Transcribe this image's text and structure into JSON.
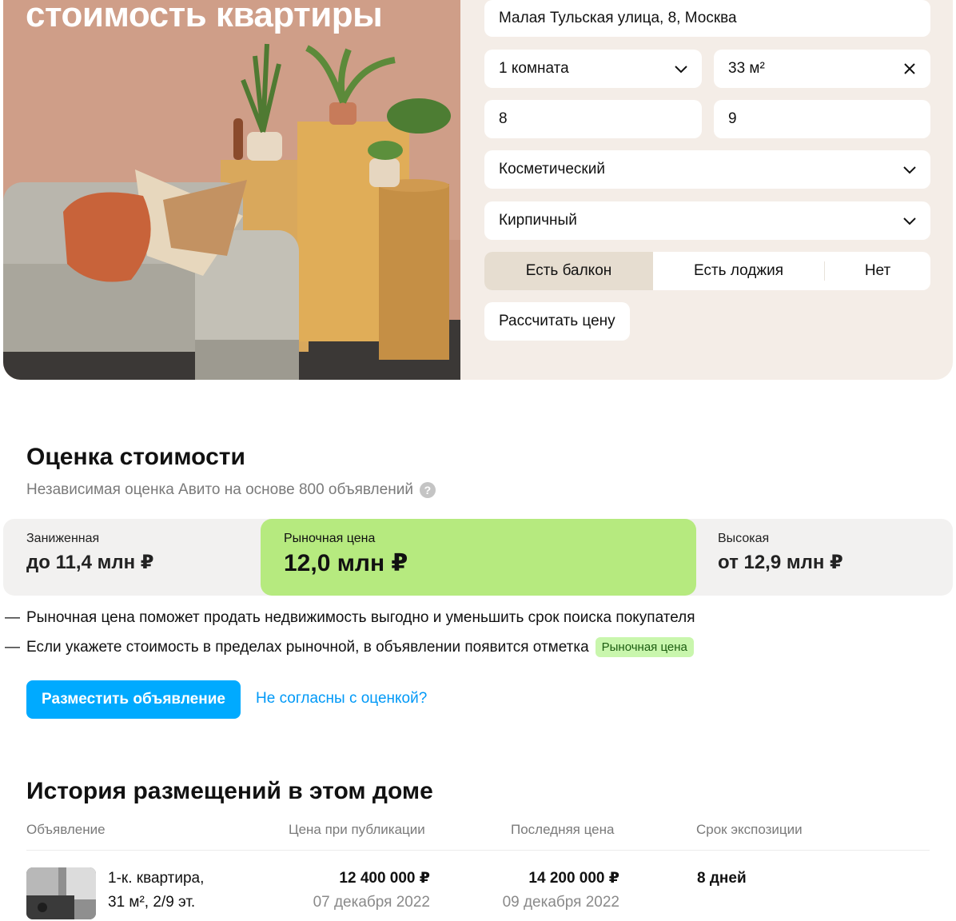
{
  "hero": {
    "title": "стоимость квартиры"
  },
  "form": {
    "address": "Малая Тульская улица, 8, Москва",
    "rooms": "1 комната",
    "area": "33 м²",
    "floor": "8",
    "floors_total": "9",
    "renovation": "Косметический",
    "house_type": "Кирпичный",
    "balcony_options": [
      "Есть балкон",
      "Есть лоджия",
      "Нет"
    ],
    "balcony_selected": "Есть балкон",
    "calc_button": "Рассчитать цену"
  },
  "evaluation": {
    "title": "Оценка стоимости",
    "subtitle": "Независимая оценка Авито на основе 800 объявлений",
    "low": {
      "label": "Заниженная",
      "value": "до 11,4 млн ₽"
    },
    "market": {
      "label": "Рыночная цена",
      "value": "12,0 млн ₽"
    },
    "high": {
      "label": "Высокая",
      "value": "от 12,9 млн ₽"
    },
    "bullets": [
      "Рыночная цена поможет продать недвижимость выгодно и уменьшить срок поиска покупателя",
      "Если укажете стоимость в пределах рыночной, в объявлении появится отметка"
    ],
    "badge": "Рыночная цена",
    "post_button": "Разместить объявление",
    "disagree_link": "Не согласны с оценкой?"
  },
  "history": {
    "title": "История размещений в этом доме",
    "columns": [
      "Объявление",
      "Цена при публикации",
      "Последняя цена",
      "Срок экспозиции"
    ],
    "rows": [
      {
        "title_line1": "1-к. квартира,",
        "title_line2": "31 м², 2/9 эт.",
        "pub_price": "12 400 000 ₽",
        "pub_date": "07 декабря 2022",
        "last_price": "14 200 000 ₽",
        "last_date": "09 декабря 2022",
        "duration": "8 дней"
      }
    ]
  },
  "colors": {
    "hero_bg": "#f4ede7",
    "market_green": "#b6ea7f",
    "primary_blue": "#00aaff",
    "link_blue": "#0099f7",
    "badge_bg": "#c9f6ad"
  }
}
